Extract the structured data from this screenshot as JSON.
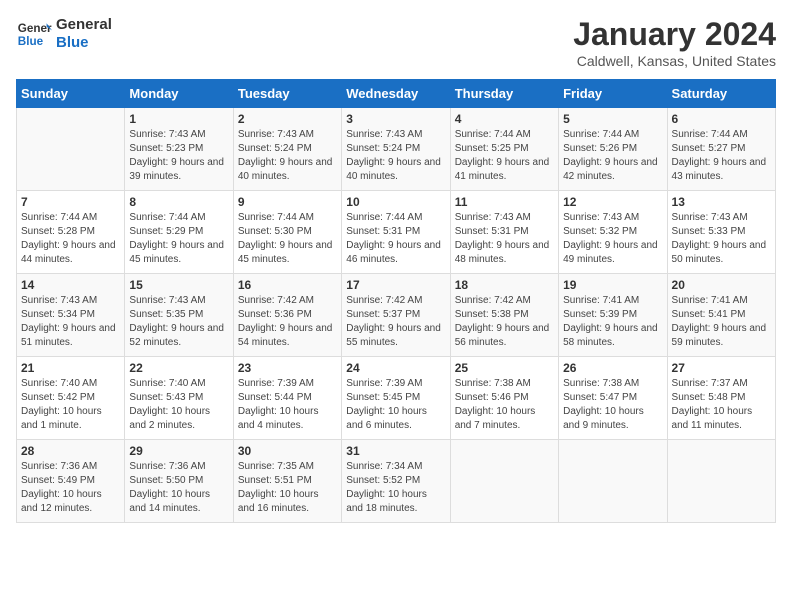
{
  "header": {
    "logo_text_general": "General",
    "logo_text_blue": "Blue",
    "month_title": "January 2024",
    "location": "Caldwell, Kansas, United States"
  },
  "days_of_week": [
    "Sunday",
    "Monday",
    "Tuesday",
    "Wednesday",
    "Thursday",
    "Friday",
    "Saturday"
  ],
  "weeks": [
    [
      {
        "num": "",
        "sunrise": "",
        "sunset": "",
        "daylight": ""
      },
      {
        "num": "1",
        "sunrise": "Sunrise: 7:43 AM",
        "sunset": "Sunset: 5:23 PM",
        "daylight": "Daylight: 9 hours and 39 minutes."
      },
      {
        "num": "2",
        "sunrise": "Sunrise: 7:43 AM",
        "sunset": "Sunset: 5:24 PM",
        "daylight": "Daylight: 9 hours and 40 minutes."
      },
      {
        "num": "3",
        "sunrise": "Sunrise: 7:43 AM",
        "sunset": "Sunset: 5:24 PM",
        "daylight": "Daylight: 9 hours and 40 minutes."
      },
      {
        "num": "4",
        "sunrise": "Sunrise: 7:44 AM",
        "sunset": "Sunset: 5:25 PM",
        "daylight": "Daylight: 9 hours and 41 minutes."
      },
      {
        "num": "5",
        "sunrise": "Sunrise: 7:44 AM",
        "sunset": "Sunset: 5:26 PM",
        "daylight": "Daylight: 9 hours and 42 minutes."
      },
      {
        "num": "6",
        "sunrise": "Sunrise: 7:44 AM",
        "sunset": "Sunset: 5:27 PM",
        "daylight": "Daylight: 9 hours and 43 minutes."
      }
    ],
    [
      {
        "num": "7",
        "sunrise": "Sunrise: 7:44 AM",
        "sunset": "Sunset: 5:28 PM",
        "daylight": "Daylight: 9 hours and 44 minutes."
      },
      {
        "num": "8",
        "sunrise": "Sunrise: 7:44 AM",
        "sunset": "Sunset: 5:29 PM",
        "daylight": "Daylight: 9 hours and 45 minutes."
      },
      {
        "num": "9",
        "sunrise": "Sunrise: 7:44 AM",
        "sunset": "Sunset: 5:30 PM",
        "daylight": "Daylight: 9 hours and 45 minutes."
      },
      {
        "num": "10",
        "sunrise": "Sunrise: 7:44 AM",
        "sunset": "Sunset: 5:31 PM",
        "daylight": "Daylight: 9 hours and 46 minutes."
      },
      {
        "num": "11",
        "sunrise": "Sunrise: 7:43 AM",
        "sunset": "Sunset: 5:31 PM",
        "daylight": "Daylight: 9 hours and 48 minutes."
      },
      {
        "num": "12",
        "sunrise": "Sunrise: 7:43 AM",
        "sunset": "Sunset: 5:32 PM",
        "daylight": "Daylight: 9 hours and 49 minutes."
      },
      {
        "num": "13",
        "sunrise": "Sunrise: 7:43 AM",
        "sunset": "Sunset: 5:33 PM",
        "daylight": "Daylight: 9 hours and 50 minutes."
      }
    ],
    [
      {
        "num": "14",
        "sunrise": "Sunrise: 7:43 AM",
        "sunset": "Sunset: 5:34 PM",
        "daylight": "Daylight: 9 hours and 51 minutes."
      },
      {
        "num": "15",
        "sunrise": "Sunrise: 7:43 AM",
        "sunset": "Sunset: 5:35 PM",
        "daylight": "Daylight: 9 hours and 52 minutes."
      },
      {
        "num": "16",
        "sunrise": "Sunrise: 7:42 AM",
        "sunset": "Sunset: 5:36 PM",
        "daylight": "Daylight: 9 hours and 54 minutes."
      },
      {
        "num": "17",
        "sunrise": "Sunrise: 7:42 AM",
        "sunset": "Sunset: 5:37 PM",
        "daylight": "Daylight: 9 hours and 55 minutes."
      },
      {
        "num": "18",
        "sunrise": "Sunrise: 7:42 AM",
        "sunset": "Sunset: 5:38 PM",
        "daylight": "Daylight: 9 hours and 56 minutes."
      },
      {
        "num": "19",
        "sunrise": "Sunrise: 7:41 AM",
        "sunset": "Sunset: 5:39 PM",
        "daylight": "Daylight: 9 hours and 58 minutes."
      },
      {
        "num": "20",
        "sunrise": "Sunrise: 7:41 AM",
        "sunset": "Sunset: 5:41 PM",
        "daylight": "Daylight: 9 hours and 59 minutes."
      }
    ],
    [
      {
        "num": "21",
        "sunrise": "Sunrise: 7:40 AM",
        "sunset": "Sunset: 5:42 PM",
        "daylight": "Daylight: 10 hours and 1 minute."
      },
      {
        "num": "22",
        "sunrise": "Sunrise: 7:40 AM",
        "sunset": "Sunset: 5:43 PM",
        "daylight": "Daylight: 10 hours and 2 minutes."
      },
      {
        "num": "23",
        "sunrise": "Sunrise: 7:39 AM",
        "sunset": "Sunset: 5:44 PM",
        "daylight": "Daylight: 10 hours and 4 minutes."
      },
      {
        "num": "24",
        "sunrise": "Sunrise: 7:39 AM",
        "sunset": "Sunset: 5:45 PM",
        "daylight": "Daylight: 10 hours and 6 minutes."
      },
      {
        "num": "25",
        "sunrise": "Sunrise: 7:38 AM",
        "sunset": "Sunset: 5:46 PM",
        "daylight": "Daylight: 10 hours and 7 minutes."
      },
      {
        "num": "26",
        "sunrise": "Sunrise: 7:38 AM",
        "sunset": "Sunset: 5:47 PM",
        "daylight": "Daylight: 10 hours and 9 minutes."
      },
      {
        "num": "27",
        "sunrise": "Sunrise: 7:37 AM",
        "sunset": "Sunset: 5:48 PM",
        "daylight": "Daylight: 10 hours and 11 minutes."
      }
    ],
    [
      {
        "num": "28",
        "sunrise": "Sunrise: 7:36 AM",
        "sunset": "Sunset: 5:49 PM",
        "daylight": "Daylight: 10 hours and 12 minutes."
      },
      {
        "num": "29",
        "sunrise": "Sunrise: 7:36 AM",
        "sunset": "Sunset: 5:50 PM",
        "daylight": "Daylight: 10 hours and 14 minutes."
      },
      {
        "num": "30",
        "sunrise": "Sunrise: 7:35 AM",
        "sunset": "Sunset: 5:51 PM",
        "daylight": "Daylight: 10 hours and 16 minutes."
      },
      {
        "num": "31",
        "sunrise": "Sunrise: 7:34 AM",
        "sunset": "Sunset: 5:52 PM",
        "daylight": "Daylight: 10 hours and 18 minutes."
      },
      {
        "num": "",
        "sunrise": "",
        "sunset": "",
        "daylight": ""
      },
      {
        "num": "",
        "sunrise": "",
        "sunset": "",
        "daylight": ""
      },
      {
        "num": "",
        "sunrise": "",
        "sunset": "",
        "daylight": ""
      }
    ]
  ]
}
